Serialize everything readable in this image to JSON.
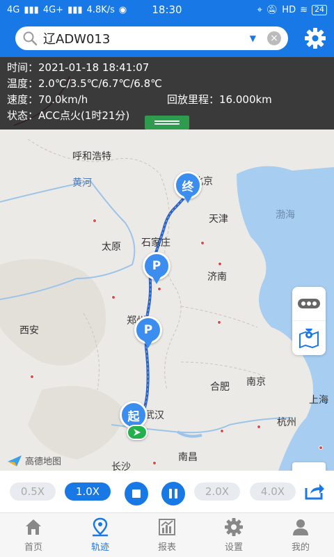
{
  "status_bar": {
    "signal1": "4G",
    "signal2": "4G+",
    "net_speed": "4.8K/s",
    "time": "18:30",
    "hd": "HD",
    "battery": "24"
  },
  "header": {
    "search_value": "辽ADW013"
  },
  "info_panel": {
    "time": "时间：2021-01-18 18:41:07",
    "temperature": "温度：2.0℃/3.5℃/6.7℃/6.8℃",
    "speed": "速度：70.0km/h",
    "mileage": "回放里程：16.000km",
    "state": "状态：ACC点火(1时21分)"
  },
  "map": {
    "cities": {
      "huhehaote": "呼和浩特",
      "beijing": "北京",
      "tianjin": "天津",
      "bohai": "渤海",
      "taiyuan": "太原",
      "shijiazhuang": "石家庄",
      "jinan": "济南",
      "huanghe": "黄河",
      "xian": "西安",
      "zhengzhou": "郑州",
      "hefei": "合肥",
      "nanjing": "南京",
      "shanghai": "上海",
      "hangzhou": "杭州",
      "wuhan": "武汉",
      "nanchang": "南昌",
      "changsha": "长沙"
    },
    "pins": {
      "end": "终",
      "parking": "P",
      "start": "起"
    },
    "provider": "高德地图",
    "zoom_in": "+",
    "zoom_out": "−"
  },
  "playback": {
    "speeds": [
      "0.5X",
      "1.0X",
      "2.0X",
      "4.0X"
    ],
    "active_speed": "1.0X"
  },
  "tabs": [
    {
      "label": "首页",
      "icon": "home-icon"
    },
    {
      "label": "轨迹",
      "icon": "track-icon"
    },
    {
      "label": "报表",
      "icon": "report-icon"
    },
    {
      "label": "设置",
      "icon": "settings-icon"
    },
    {
      "label": "我的",
      "icon": "user-icon"
    }
  ],
  "colors": {
    "accent": "#1878e6",
    "track": "#3b6fd6",
    "car": "#22b14c",
    "info_handle": "#2e9b4e"
  }
}
